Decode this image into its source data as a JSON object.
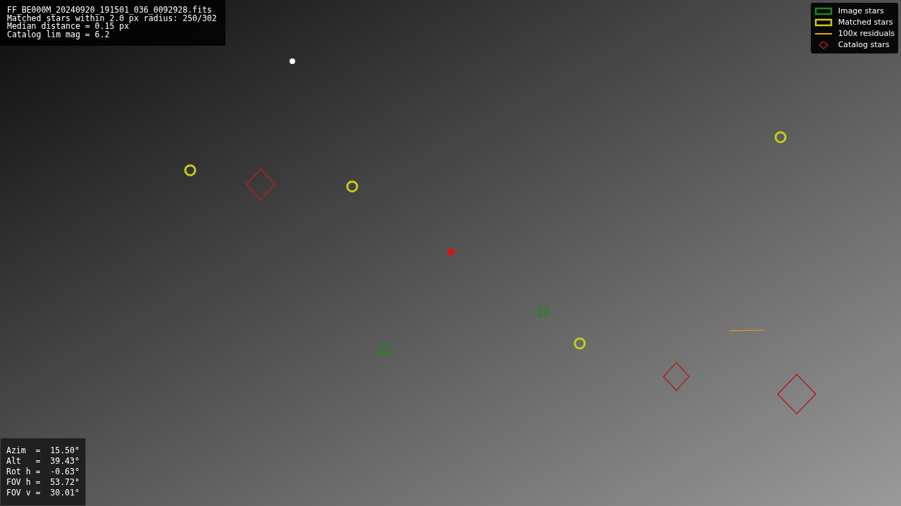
{
  "info": {
    "lines": [
      "FF_BE000M_20240920_191501_036_0092928.fits",
      "Matched stars within 2.0 px radius: 250/302",
      "Median distance = 0.15 px",
      "Catalog lim mag = 6.2"
    ]
  },
  "legend": {
    "items": [
      {
        "kind": "box",
        "color": "#1a8c1a",
        "label": "Image stars"
      },
      {
        "kind": "box",
        "color": "#c8c81e",
        "label": "Matched stars"
      },
      {
        "kind": "line",
        "color": "#f0a020",
        "label": "100x residuals"
      },
      {
        "kind": "diamond",
        "color": "#b02020",
        "label": "Catalog stars"
      }
    ]
  },
  "pointing": {
    "lines": [
      "Azim  =  15.50°",
      "Alt   =  39.43°",
      "Rot h =  -0.63°",
      "FOV h =  53.72°",
      "FOV v =  30.01°"
    ]
  }
}
